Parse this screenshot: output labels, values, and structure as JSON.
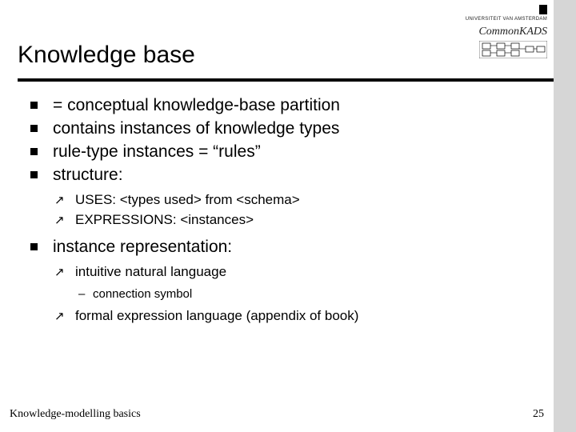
{
  "header": {
    "uva_text": "UNIVERSITEIT VAN AMSTERDAM",
    "commonkads": "CommonKADS"
  },
  "title": "Knowledge base",
  "bullets": [
    {
      "level": 1,
      "text": "= conceptual knowledge-base partition"
    },
    {
      "level": 1,
      "text": "contains instances of knowledge types"
    },
    {
      "level": 1,
      "text": "rule-type instances = “rules”"
    },
    {
      "level": 1,
      "text": "structure:"
    },
    {
      "level": 2,
      "text": "USES: <types used> from <schema>"
    },
    {
      "level": 2,
      "text": "EXPRESSIONS: <instances>"
    },
    {
      "level": 1,
      "text": "instance representation:"
    },
    {
      "level": 2,
      "text": "intuitive natural language"
    },
    {
      "level": 3,
      "text": "connection symbol"
    },
    {
      "level": 2,
      "text": "formal expression language (appendix of book)"
    }
  ],
  "footer": {
    "left": "Knowledge-modelling basics",
    "page": "25"
  }
}
